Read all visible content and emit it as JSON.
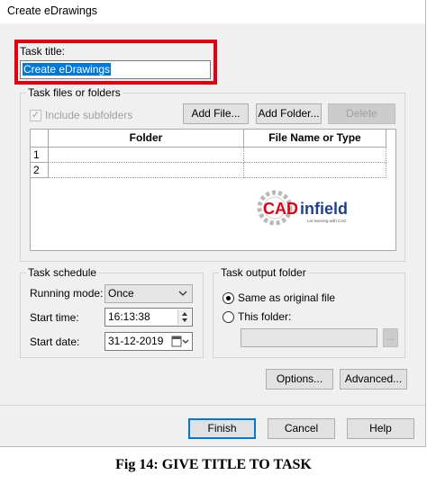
{
  "window": {
    "title": "Create eDrawings"
  },
  "task_title": {
    "label": "Task title:",
    "value": "Create eDrawings"
  },
  "files": {
    "group_label": "Task files or folders",
    "include_subfolders": {
      "label": "Include subfolders",
      "checked": true
    },
    "add_file": "Add File...",
    "add_folder": "Add Folder...",
    "delete": "Delete",
    "columns": [
      "Folder",
      "File Name or Type"
    ],
    "rows": [
      "1",
      "2"
    ]
  },
  "logo": {
    "text_cad": "CAD",
    "text_infield": "infield",
    "tagline": "Let learning with CAD"
  },
  "schedule": {
    "group_label": "Task schedule",
    "running_mode_label": "Running mode:",
    "running_mode_value": "Once",
    "start_time_label": "Start time:",
    "start_time_value": "16:13:38",
    "start_date_label": "Start date:",
    "start_date_value": "31-12-2019"
  },
  "output": {
    "group_label": "Task output folder",
    "same_as_original": "Same as original file",
    "this_folder": "This folder:",
    "browse": "..."
  },
  "buttons": {
    "options": "Options...",
    "advanced": "Advanced...",
    "finish": "Finish",
    "cancel": "Cancel",
    "help": "Help"
  },
  "caption": "Fig 14: GIVE TITLE TO TASK",
  "colors": {
    "highlight": "#e3000f",
    "selection": "#0078d7",
    "logo_red": "#e3000f",
    "logo_blue": "#1f3f8f"
  }
}
